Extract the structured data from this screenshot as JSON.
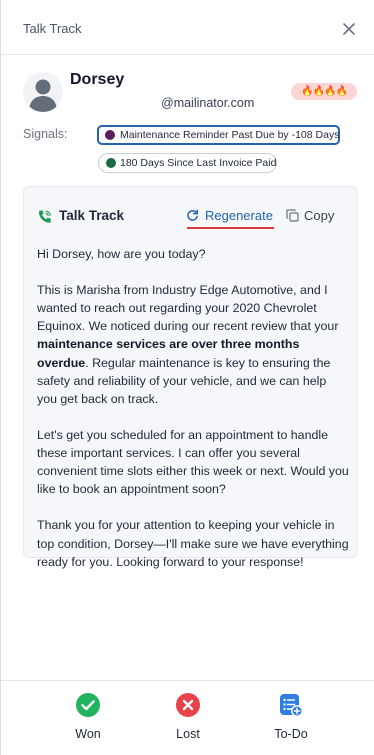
{
  "header": {
    "title": "Talk Track",
    "close_icon": "close-icon"
  },
  "contact": {
    "name": "Dorsey",
    "email": "@mailinator.com",
    "heat_badge": "🔥🔥🔥🔥",
    "heat_level": 4
  },
  "signals": {
    "label": "Signals:",
    "items": [
      {
        "text": "Maintenance Reminder Past Due by -108 Days",
        "dot_color": "#5b1f5e",
        "selected": true
      },
      {
        "text": "180 Days Since Last Invoice Paid",
        "dot_color": "#1d6b45",
        "selected": false
      }
    ]
  },
  "talk_track": {
    "title": "Talk Track",
    "regenerate_label": "Regenerate",
    "copy_label": "Copy",
    "greeting": "Hi Dorsey, how are you today?",
    "p2_before": "This is Marisha from Industry Edge Automotive, and I wanted to reach out regarding your 2020 Chevrolet Equinox. We noticed during our recent review that your ",
    "p2_bold": "maintenance services are over three months overdue",
    "p2_after": ". Regular maintenance is key to ensuring the safety and reliability of your vehicle, and we can help you get back on track.",
    "p3": "Let's get you scheduled for an appointment to handle these important services. I can offer you several convenient time slots either this week or next. Would you like to book an appointment soon?",
    "p4": "Thank you for your attention to keeping your vehicle in top condition, Dorsey—I'll make sure we have everything ready for you. Looking forward to your response!"
  },
  "actions": {
    "won": "Won",
    "lost": "Lost",
    "todo": "To-Do"
  },
  "colors": {
    "accent": "#2563b0",
    "won": "#22b35e",
    "lost": "#e8424b",
    "todo": "#2f7de1",
    "underline": "#e03b3b"
  }
}
